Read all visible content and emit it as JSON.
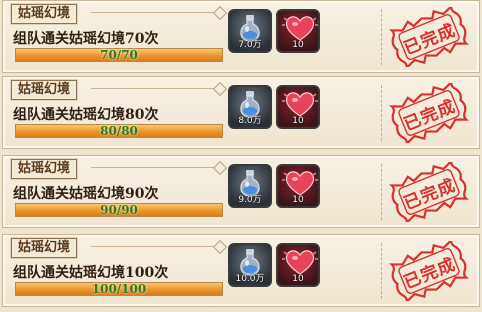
{
  "tasks": [
    {
      "category": "姑瑶幻境",
      "title": "组队通关姑瑶幻境70次",
      "progress_text": "70/70",
      "progress": 1.0,
      "rewards": {
        "exp_amount": "7.0万",
        "favor_amount": "10"
      },
      "status": "已完成"
    },
    {
      "category": "姑瑶幻境",
      "title": "组队通关姑瑶幻境80次",
      "progress_text": "80/80",
      "progress": 1.0,
      "rewards": {
        "exp_amount": "8.0万",
        "favor_amount": "10"
      },
      "status": "已完成"
    },
    {
      "category": "姑瑶幻境",
      "title": "组队通关姑瑶幻境90次",
      "progress_text": "90/90",
      "progress": 1.0,
      "rewards": {
        "exp_amount": "9.0万",
        "favor_amount": "10"
      },
      "status": "已完成"
    },
    {
      "category": "姑瑶幻境",
      "title": "组队通关姑瑶幻境100次",
      "progress_text": "100/100",
      "progress": 1.0,
      "rewards": {
        "exp_amount": "10.0万",
        "favor_amount": "10"
      },
      "status": "已完成"
    }
  ],
  "icons": {
    "exp": "potion-bottle-icon",
    "favor": "heart-icon",
    "completed": "completed-stamp-icon"
  },
  "colors": {
    "stamp": "#d8302e",
    "progress_text": "#2e7a22",
    "progress_fill": "#e9922a"
  }
}
